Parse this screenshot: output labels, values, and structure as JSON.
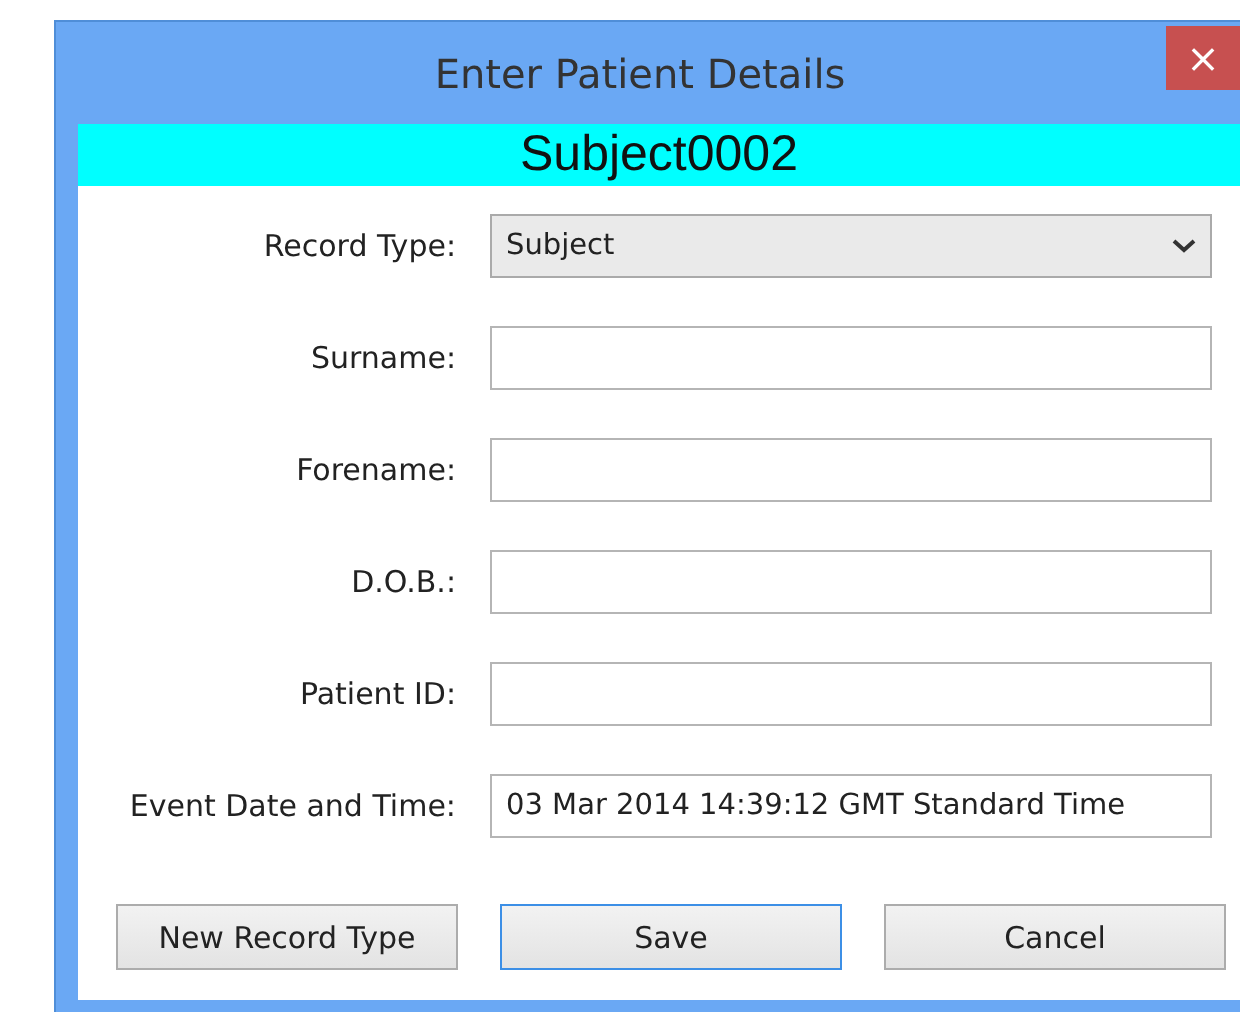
{
  "window": {
    "title": "Enter Patient Details",
    "close_button": "×"
  },
  "header": {
    "title": "Subject0002"
  },
  "fields": [
    {
      "label": "Record Type:",
      "kind": "dropdown",
      "value": "Subject"
    },
    {
      "label": "Surname:",
      "kind": "text"
    },
    {
      "label": "Forename:",
      "kind": "text"
    },
    {
      "label": "D.O.B.:",
      "kind": "text"
    },
    {
      "label": "Patient ID:",
      "kind": "text"
    },
    {
      "label": "Event Date and Time:",
      "kind": "text",
      "value": "03 Mar 2014 14:39:12 GMT Standard Time"
    }
  ],
  "buttons": [
    {
      "label": "New Record Type",
      "default": false
    },
    {
      "label": "Save",
      "default": true
    },
    {
      "label": "Cancel",
      "default": false
    }
  ]
}
